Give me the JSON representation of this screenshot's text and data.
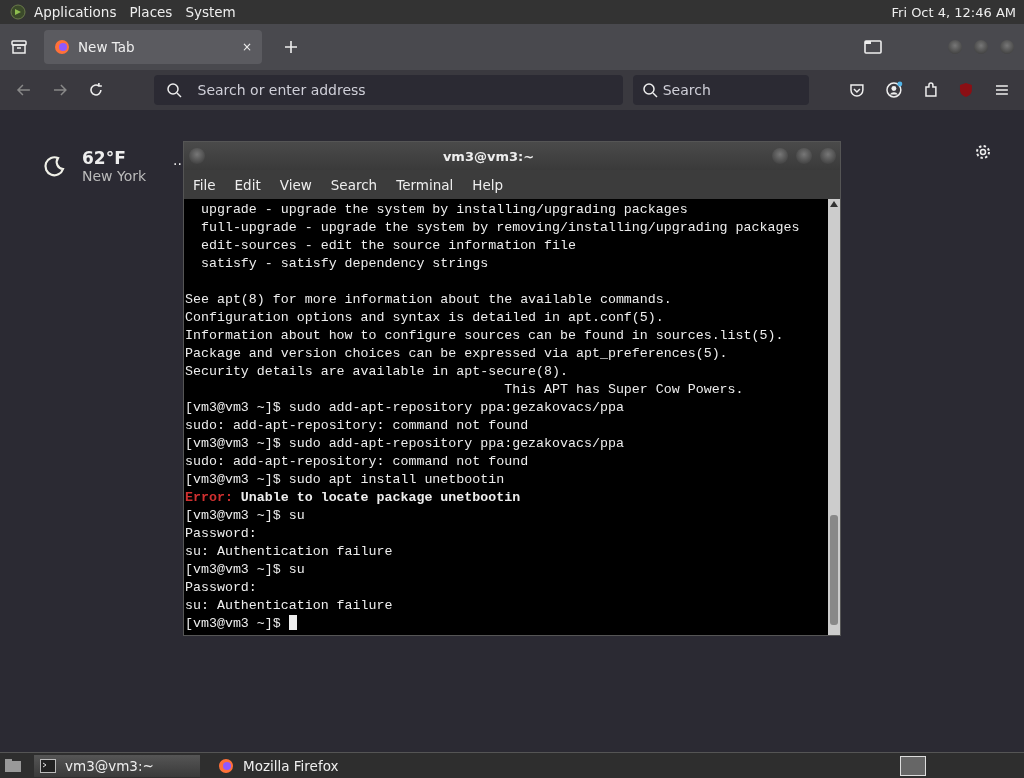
{
  "top_panel": {
    "menus": [
      "Applications",
      "Places",
      "System"
    ],
    "clock": "Fri Oct  4, 12:46 AM"
  },
  "browser": {
    "tabs": [
      {
        "label": "New Tab",
        "selected": true,
        "close": "×"
      }
    ],
    "address": {
      "placeholder": "Search or enter address"
    },
    "search": {
      "placeholder": "Search"
    }
  },
  "weather": {
    "temperature": "62°F",
    "city": "New York",
    "more": ".."
  },
  "terminal": {
    "title": "vm3@vm3:~",
    "menus": [
      "File",
      "Edit",
      "View",
      "Search",
      "Terminal",
      "Help"
    ],
    "lines": [
      {
        "kind": "out",
        "text": "  upgrade - upgrade the system by installing/upgrading packages"
      },
      {
        "kind": "out",
        "text": "  full-upgrade - upgrade the system by removing/installing/upgrading packages"
      },
      {
        "kind": "out",
        "text": "  edit-sources - edit the source information file"
      },
      {
        "kind": "out",
        "text": "  satisfy - satisfy dependency strings"
      },
      {
        "kind": "blank"
      },
      {
        "kind": "out",
        "text": "See apt(8) for more information about the available commands."
      },
      {
        "kind": "out",
        "text": "Configuration options and syntax is detailed in apt.conf(5)."
      },
      {
        "kind": "out",
        "text": "Information about how to configure sources can be found in sources.list(5)."
      },
      {
        "kind": "out",
        "text": "Package and version choices can be expressed via apt_preferences(5)."
      },
      {
        "kind": "out",
        "text": "Security details are available in apt-secure(8)."
      },
      {
        "kind": "out",
        "text": "                                        This APT has Super Cow Powers."
      },
      {
        "kind": "out",
        "text": "[vm3@vm3 ~]$ sudo add-apt-repository ppa:gezakovacs/ppa"
      },
      {
        "kind": "out",
        "text": "sudo: add-apt-repository: command not found"
      },
      {
        "kind": "out",
        "text": "[vm3@vm3 ~]$ sudo add-apt-repository ppa:gezakovacs/ppa"
      },
      {
        "kind": "out",
        "text": "sudo: add-apt-repository: command not found"
      },
      {
        "kind": "out",
        "text": "[vm3@vm3 ~]$ sudo apt install unetbootin"
      },
      {
        "kind": "error",
        "prefix": "Error:",
        "text": " Unable to locate package unetbootin"
      },
      {
        "kind": "out",
        "text": "[vm3@vm3 ~]$ su"
      },
      {
        "kind": "out",
        "text": "Password:"
      },
      {
        "kind": "out",
        "text": "su: Authentication failure"
      },
      {
        "kind": "out",
        "text": "[vm3@vm3 ~]$ su"
      },
      {
        "kind": "out",
        "text": "Password:"
      },
      {
        "kind": "out",
        "text": "su: Authentication failure"
      },
      {
        "kind": "prompt",
        "text": "[vm3@vm3 ~]$ "
      }
    ]
  },
  "taskbar": {
    "tasks": [
      {
        "label": "vm3@vm3:~",
        "selected": true,
        "kind": "terminal"
      },
      {
        "label": "Mozilla Firefox",
        "selected": false,
        "kind": "firefox"
      }
    ]
  }
}
